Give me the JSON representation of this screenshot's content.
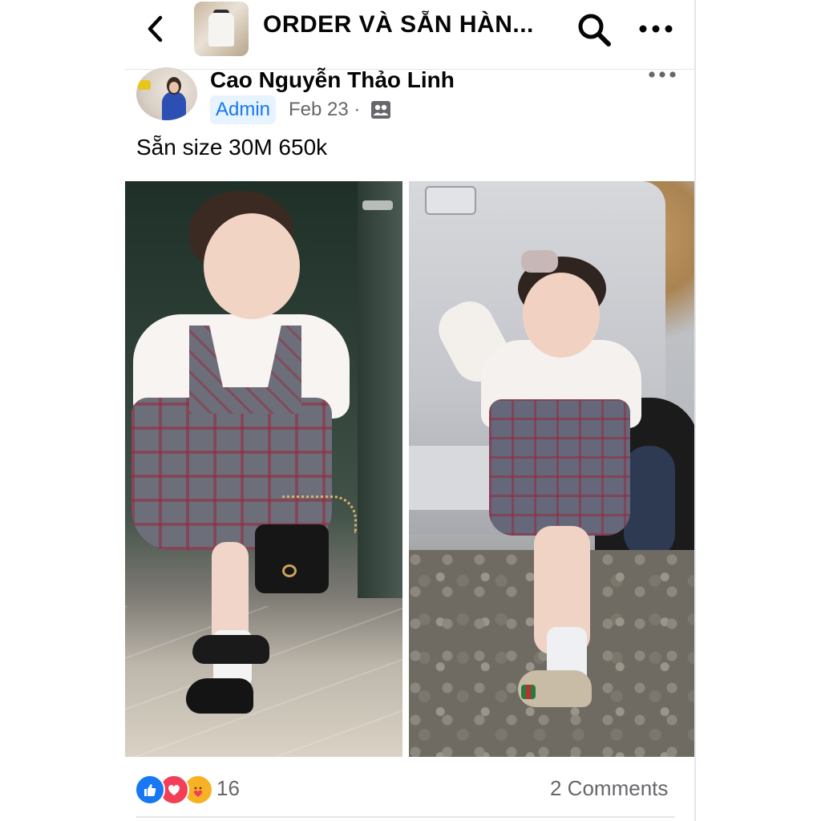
{
  "header": {
    "back_icon": "chevron-left-icon",
    "group_title": "ORDER VÀ SẴN HÀN...",
    "search_icon": "search-icon",
    "more_icon": "more-horizontal-icon"
  },
  "post": {
    "author": "Cao Nguyễn Thảo Linh",
    "role_badge": "Admin",
    "date": "Feb 23 ·",
    "privacy_icon": "group-members-icon",
    "more_icon": "more-horizontal-icon",
    "text": "Sẵn size 30M 650k"
  },
  "footer": {
    "reaction_icons": [
      "like-reaction-icon",
      "love-reaction-icon",
      "care-reaction-icon"
    ],
    "reaction_count": "16",
    "comments": "2 Comments"
  },
  "colors": {
    "accent": "#1877f2",
    "badge_bg": "#e7f3ff",
    "muted_text": "#65676b",
    "love": "#f33e58",
    "care": "#f7b125",
    "divider": "#e4e6eb"
  }
}
